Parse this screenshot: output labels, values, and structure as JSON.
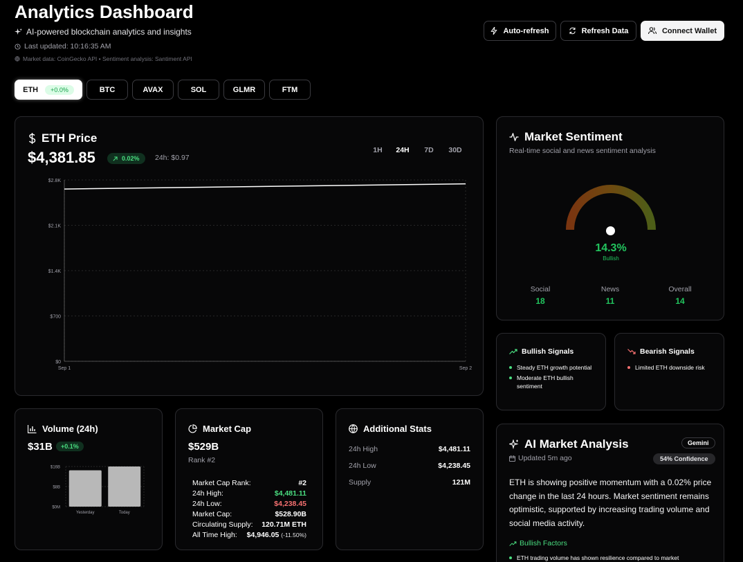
{
  "header": {
    "title": "Analytics Dashboard",
    "subtitle": "AI-powered blockchain analytics and insights",
    "last_updated": "Last updated: 10:16:35 AM",
    "sources": "Market data: CoinGecko API • Sentiment analysis: Santiment API",
    "auto_refresh": "Auto-refresh",
    "refresh_data": "Refresh Data",
    "connect_wallet": "Connect Wallet"
  },
  "tokens": [
    {
      "label": "ETH",
      "badge": "+0.0%",
      "active": true
    },
    {
      "label": "BTC"
    },
    {
      "label": "AVAX"
    },
    {
      "label": "SOL"
    },
    {
      "label": "GLMR"
    },
    {
      "label": "FTM"
    }
  ],
  "price_card": {
    "title": "ETH Price",
    "price": "$4,381.85",
    "change": "0.02%",
    "change_abs": "24h: $0.97",
    "ranges": [
      "1H",
      "24H",
      "7D",
      "30D"
    ],
    "active_range": "24H"
  },
  "chart_data": {
    "type": "line",
    "x": [
      "Sep 1",
      "Sep 2"
    ],
    "series": [
      {
        "values": [
          2660,
          2740
        ]
      }
    ],
    "yticks": [
      "$0",
      "$700",
      "$1.4K",
      "$2.1K",
      "$2.8K"
    ],
    "ylim": [
      0,
      2800
    ],
    "grid": true,
    "line_color": "#ffffff"
  },
  "sentiment": {
    "title": "Market Sentiment",
    "subtitle": "Real-time social and news sentiment analysis",
    "value": "14.3%",
    "label": "Bullish",
    "gauge_fraction": 0.5,
    "stats": [
      {
        "label": "Social",
        "value": "18"
      },
      {
        "label": "News",
        "value": "11"
      },
      {
        "label": "Overall",
        "value": "14"
      }
    ]
  },
  "bullish_signals": {
    "title": "Bullish Signals",
    "items": [
      "Steady ETH growth potential",
      "Moderate ETH bullish sentiment"
    ]
  },
  "bearish_signals": {
    "title": "Bearish Signals",
    "items": [
      "Limited ETH downside risk"
    ]
  },
  "volume": {
    "title": "Volume (24h)",
    "value": "$31B",
    "change": "+0.1%",
    "chart_data": {
      "type": "bar",
      "categories": [
        "Yesterday",
        "Today"
      ],
      "values": [
        14.5,
        16
      ],
      "yticks": [
        "$0M",
        "$8B",
        "$16B"
      ],
      "ylim": [
        0,
        16
      ]
    }
  },
  "market_cap": {
    "title": "Market Cap",
    "value": "$529B",
    "rank": "Rank #2",
    "rows": [
      {
        "label": "Market Cap Rank:",
        "value": "#2",
        "color": "#ffffff"
      },
      {
        "label": "24h High:",
        "value": "$4,481.11",
        "color": "#4ade80"
      },
      {
        "label": "24h Low:",
        "value": "$4,238.45",
        "color": "#f87171"
      },
      {
        "label": "Market Cap:",
        "value": "$528.90B",
        "color": "#ffffff"
      },
      {
        "label": "Circulating Supply:",
        "value": "120.71M ETH",
        "color": "#ffffff"
      },
      {
        "label": "All Time High:",
        "value": "$4,946.05",
        "extra": "(-11.50%)",
        "color": "#ffffff"
      }
    ]
  },
  "additional_stats": {
    "title": "Additional Stats",
    "rows": [
      {
        "label": "24h High",
        "value": "$4,481.11"
      },
      {
        "label": "24h Low",
        "value": "$4,238.45"
      },
      {
        "label": "Supply",
        "value": "121M"
      }
    ]
  },
  "ai_analysis": {
    "title": "AI Market Analysis",
    "badge": "Gemini",
    "updated": "Updated 5m ago",
    "confidence": "54% Confidence",
    "body": "ETH is showing positive momentum with a 0.02% price change in the last 24 hours. Market sentiment remains optimistic, supported by increasing trading volume and social media activity.",
    "factors_title": "Bullish Factors",
    "factors": [
      "ETH trading volume has shown resilience compared to market"
    ]
  },
  "colors": {
    "green": "#4ade80",
    "red": "#f87171",
    "card_border": "#2a2a2e"
  }
}
